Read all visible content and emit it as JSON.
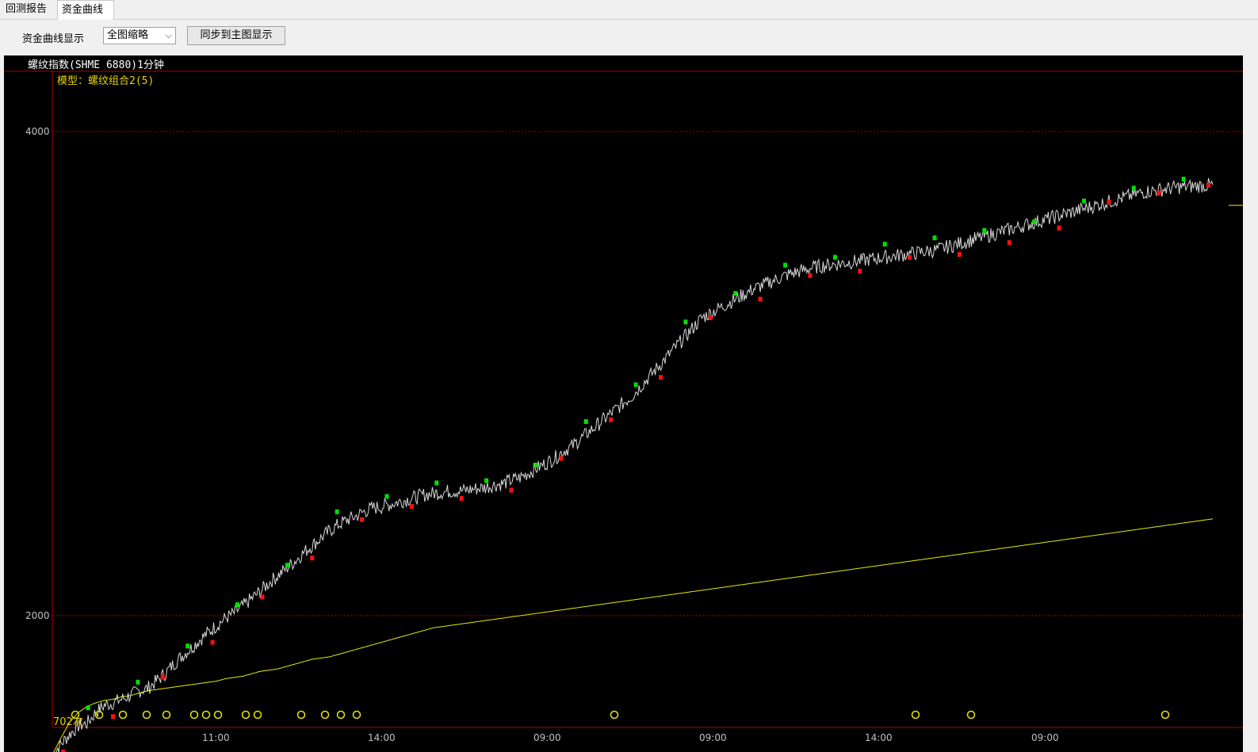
{
  "tabs": [
    {
      "label": "回测报告",
      "active": false
    },
    {
      "label": "资金曲线",
      "active": true
    }
  ],
  "toolbar": {
    "display_label": "资金曲线显示",
    "display_select": "全图缩略",
    "sync_button": "同步到主图显示"
  },
  "chart": {
    "title": "螺纹指数(SHME 6880)1分钟",
    "model": "模型：螺纹组合2(5)",
    "count": "702次",
    "colors": {
      "background": "#000000",
      "price_line": "#d8d8d8",
      "equity_line": "#e8e800",
      "grid": "#b00000",
      "buy_marker": "#ff1010",
      "sell_marker": "#00e000",
      "signal_circle": "#e8e800"
    }
  },
  "chart_data": {
    "type": "line",
    "y_ticks": [
      "4000",
      "2000"
    ],
    "x_ticks": [
      "11:00",
      "14:00",
      "09:00",
      "09:00",
      "14:00",
      "09:00"
    ],
    "series": [
      {
        "id": "price",
        "values": [
          1425,
          1470,
          1510,
          1545,
          1555,
          1600,
          1630,
          1640,
          1655,
          1670,
          1690,
          1700,
          1730,
          1760,
          1800,
          1835,
          1865,
          1900,
          1930,
          1960,
          1990,
          2010,
          2040,
          2070,
          2100,
          2135,
          2165,
          2195,
          2225,
          2260,
          2290,
          2320,
          2350,
          2375,
          2395,
          2410,
          2430,
          2445,
          2450,
          2460,
          2470,
          2480,
          2490,
          2500,
          2505,
          2510,
          2515,
          2515,
          2520,
          2525,
          2530,
          2540,
          2545,
          2560,
          2570,
          2590,
          2610,
          2630,
          2650,
          2680,
          2700,
          2730,
          2760,
          2790,
          2820,
          2850,
          2880,
          2910,
          2950,
          2990,
          3030,
          3070,
          3110,
          3150,
          3190,
          3230,
          3250,
          3270,
          3290,
          3310,
          3330,
          3350,
          3365,
          3380,
          3395,
          3410,
          3420,
          3430,
          3440,
          3445,
          3450,
          3455,
          3460,
          3465,
          3470,
          3475,
          3480,
          3485,
          3490,
          3495,
          3500,
          3505,
          3510,
          3520,
          3530,
          3540,
          3550,
          3560,
          3570,
          3580,
          3590,
          3600,
          3610,
          3620,
          3630,
          3640,
          3650,
          3660,
          3670,
          3680,
          3690,
          3700,
          3710,
          3720,
          3730,
          3740,
          3750,
          3755,
          3760,
          3765,
          3770,
          3772,
          3775,
          3777,
          3780
        ]
      },
      {
        "id": "equity",
        "values": [
          1425,
          1495,
          1560,
          1600,
          1625,
          1640,
          1650,
          1655,
          1665,
          1670,
          1680,
          1690,
          1695,
          1700,
          1705,
          1710,
          1715,
          1720,
          1725,
          1730,
          1740,
          1745,
          1750,
          1760,
          1770,
          1775,
          1780,
          1790,
          1800,
          1810,
          1820,
          1825,
          1830,
          1840,
          1850,
          1860,
          1870,
          1880,
          1890,
          1900,
          1910,
          1920,
          1930,
          1940,
          1950,
          1955,
          1960,
          1965,
          1970,
          1975,
          1980,
          1985,
          1990,
          1995,
          2000,
          2005,
          2010,
          2015,
          2020,
          2025,
          2030,
          2035,
          2040,
          2045,
          2050,
          2055,
          2060,
          2065,
          2070,
          2075,
          2080,
          2085,
          2090,
          2095,
          2100,
          2105,
          2110,
          2115,
          2120,
          2125,
          2130,
          2135,
          2140,
          2145,
          2150,
          2155,
          2160,
          2165,
          2170,
          2175,
          2180,
          2185,
          2190,
          2195,
          2200,
          2205,
          2210,
          2215,
          2220,
          2225,
          2230,
          2235,
          2240,
          2245,
          2250,
          2255,
          2260,
          2265,
          2270,
          2275,
          2280,
          2285,
          2290,
          2295,
          2300,
          2305,
          2310,
          2315,
          2320,
          2325,
          2330,
          2335,
          2340,
          2345,
          2350,
          2355,
          2360,
          2365,
          2370,
          2375,
          2380,
          2385,
          2390,
          2395,
          2400
        ]
      }
    ]
  }
}
